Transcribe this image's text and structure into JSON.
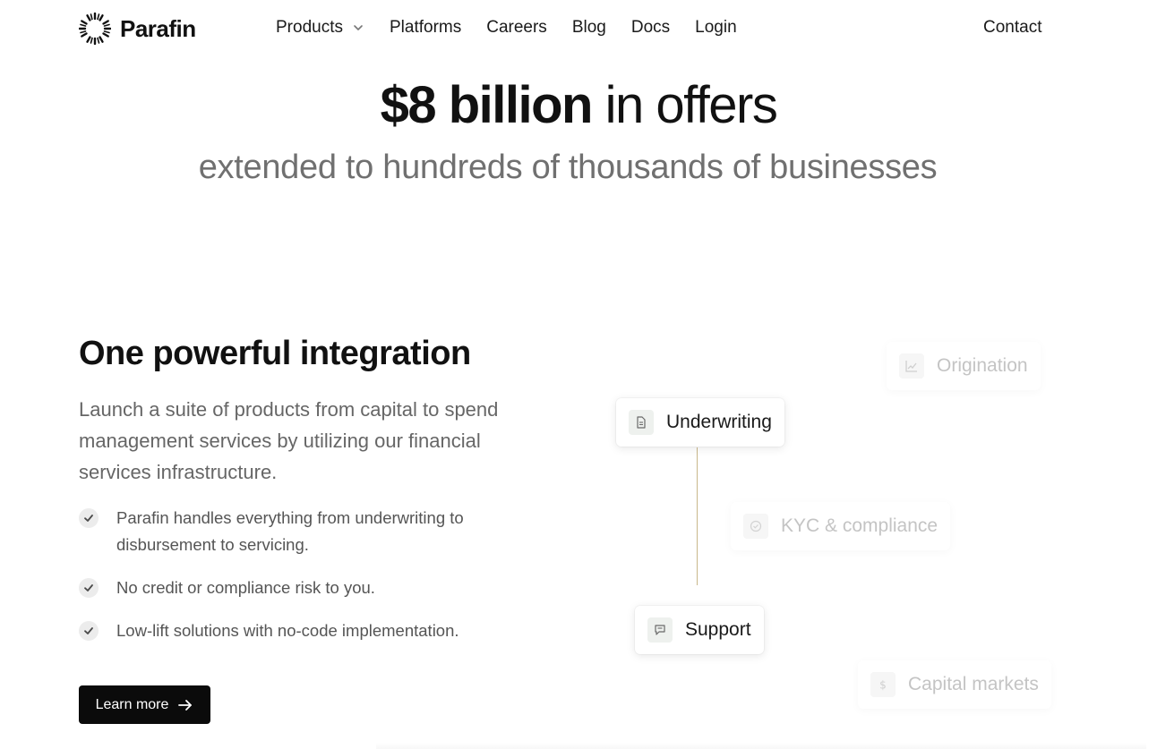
{
  "brand": {
    "name": "Parafin"
  },
  "nav": {
    "links": [
      {
        "label": "Products",
        "has_dropdown": true
      },
      {
        "label": "Platforms"
      },
      {
        "label": "Careers"
      },
      {
        "label": "Blog"
      },
      {
        "label": "Docs"
      },
      {
        "label": "Login"
      }
    ],
    "contact_label": "Contact"
  },
  "hero": {
    "title_bold": "$8 billion",
    "title_rest": " in offers",
    "subtitle": "extended to hundreds of thousands of businesses"
  },
  "integration": {
    "title": "One powerful integration",
    "description": "Launch a suite of products from capital to spend management services by utilizing our financial services infrastructure.",
    "features": [
      "Parafin handles everything from underwriting to disbursement to servicing.",
      "No credit or compliance risk to you.",
      "Low-lift solutions with no-code implementation."
    ],
    "cta_label": "Learn more"
  },
  "diagram": {
    "cards": [
      {
        "label": "Origination",
        "icon": "chart-icon",
        "active": false
      },
      {
        "label": "Underwriting",
        "icon": "document-icon",
        "active": true
      },
      {
        "label": "KYC & compliance",
        "icon": "check-circle-icon",
        "active": false
      },
      {
        "label": "Support",
        "icon": "chat-icon",
        "active": true
      },
      {
        "label": "Capital markets",
        "icon": "dollar-icon",
        "active": false
      }
    ],
    "connector_color": "#c9b78a"
  },
  "colors": {
    "text_primary": "#111111",
    "text_muted": "#707070",
    "button_bg": "#0b0b0b"
  }
}
